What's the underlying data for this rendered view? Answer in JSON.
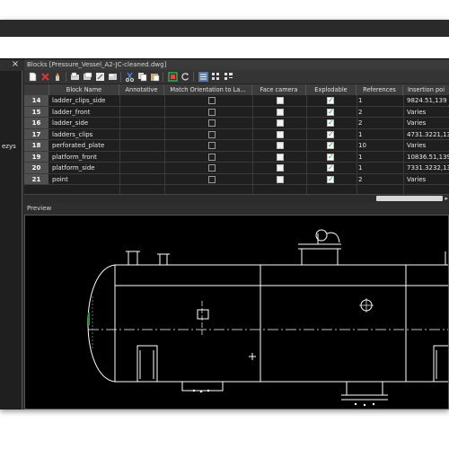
{
  "palette": {
    "panel": "#2b2b2b",
    "drawing_bg": "#000000",
    "drawing_line": "#ffffff",
    "accent_green": "#1a9d2a"
  },
  "left_panel": {
    "close_glyph": "×",
    "text_fragment_1": "ezys",
    "text_fragment_2": ""
  },
  "window": {
    "title": "Blocks [Pressure_Vessel_A2-JC-cleaned.dwg]"
  },
  "toolbar": {
    "icons": [
      "new-block-icon",
      "delete-icon",
      "purge-icon",
      "insert-icon",
      "write-block-icon",
      "block-editor-icon",
      "cut-icon",
      "copy-icon",
      "paste-icon",
      "select-icon",
      "redefine-icon",
      "view-list-icon",
      "view-icons-icon",
      "view-details-icon"
    ]
  },
  "table": {
    "columns": [
      "",
      "Block Name",
      "Annotative",
      "Match Orientation to La...",
      "Face camera",
      "Explodable",
      "References",
      "Insertion poi"
    ],
    "rows": [
      {
        "num": "14",
        "name": "ladder_clips_side",
        "refs": "1",
        "insertion": "9824.51,139"
      },
      {
        "num": "15",
        "name": "ladder_front",
        "refs": "2",
        "insertion": "Varies"
      },
      {
        "num": "16",
        "name": "ladder_side",
        "refs": "2",
        "insertion": "Varies"
      },
      {
        "num": "17",
        "name": "ladders_clips",
        "refs": "1",
        "insertion": "4731.3221,13"
      },
      {
        "num": "18",
        "name": "perforated_plate",
        "refs": "10",
        "insertion": "Varies"
      },
      {
        "num": "19",
        "name": "platform_front",
        "refs": "1",
        "insertion": "10836.51,139"
      },
      {
        "num": "20",
        "name": "platform_side",
        "refs": "1",
        "insertion": "7331.3232,13"
      },
      {
        "num": "21",
        "name": "point",
        "refs": "2",
        "insertion": "Varies"
      }
    ]
  },
  "preview": {
    "label": "Preview"
  }
}
